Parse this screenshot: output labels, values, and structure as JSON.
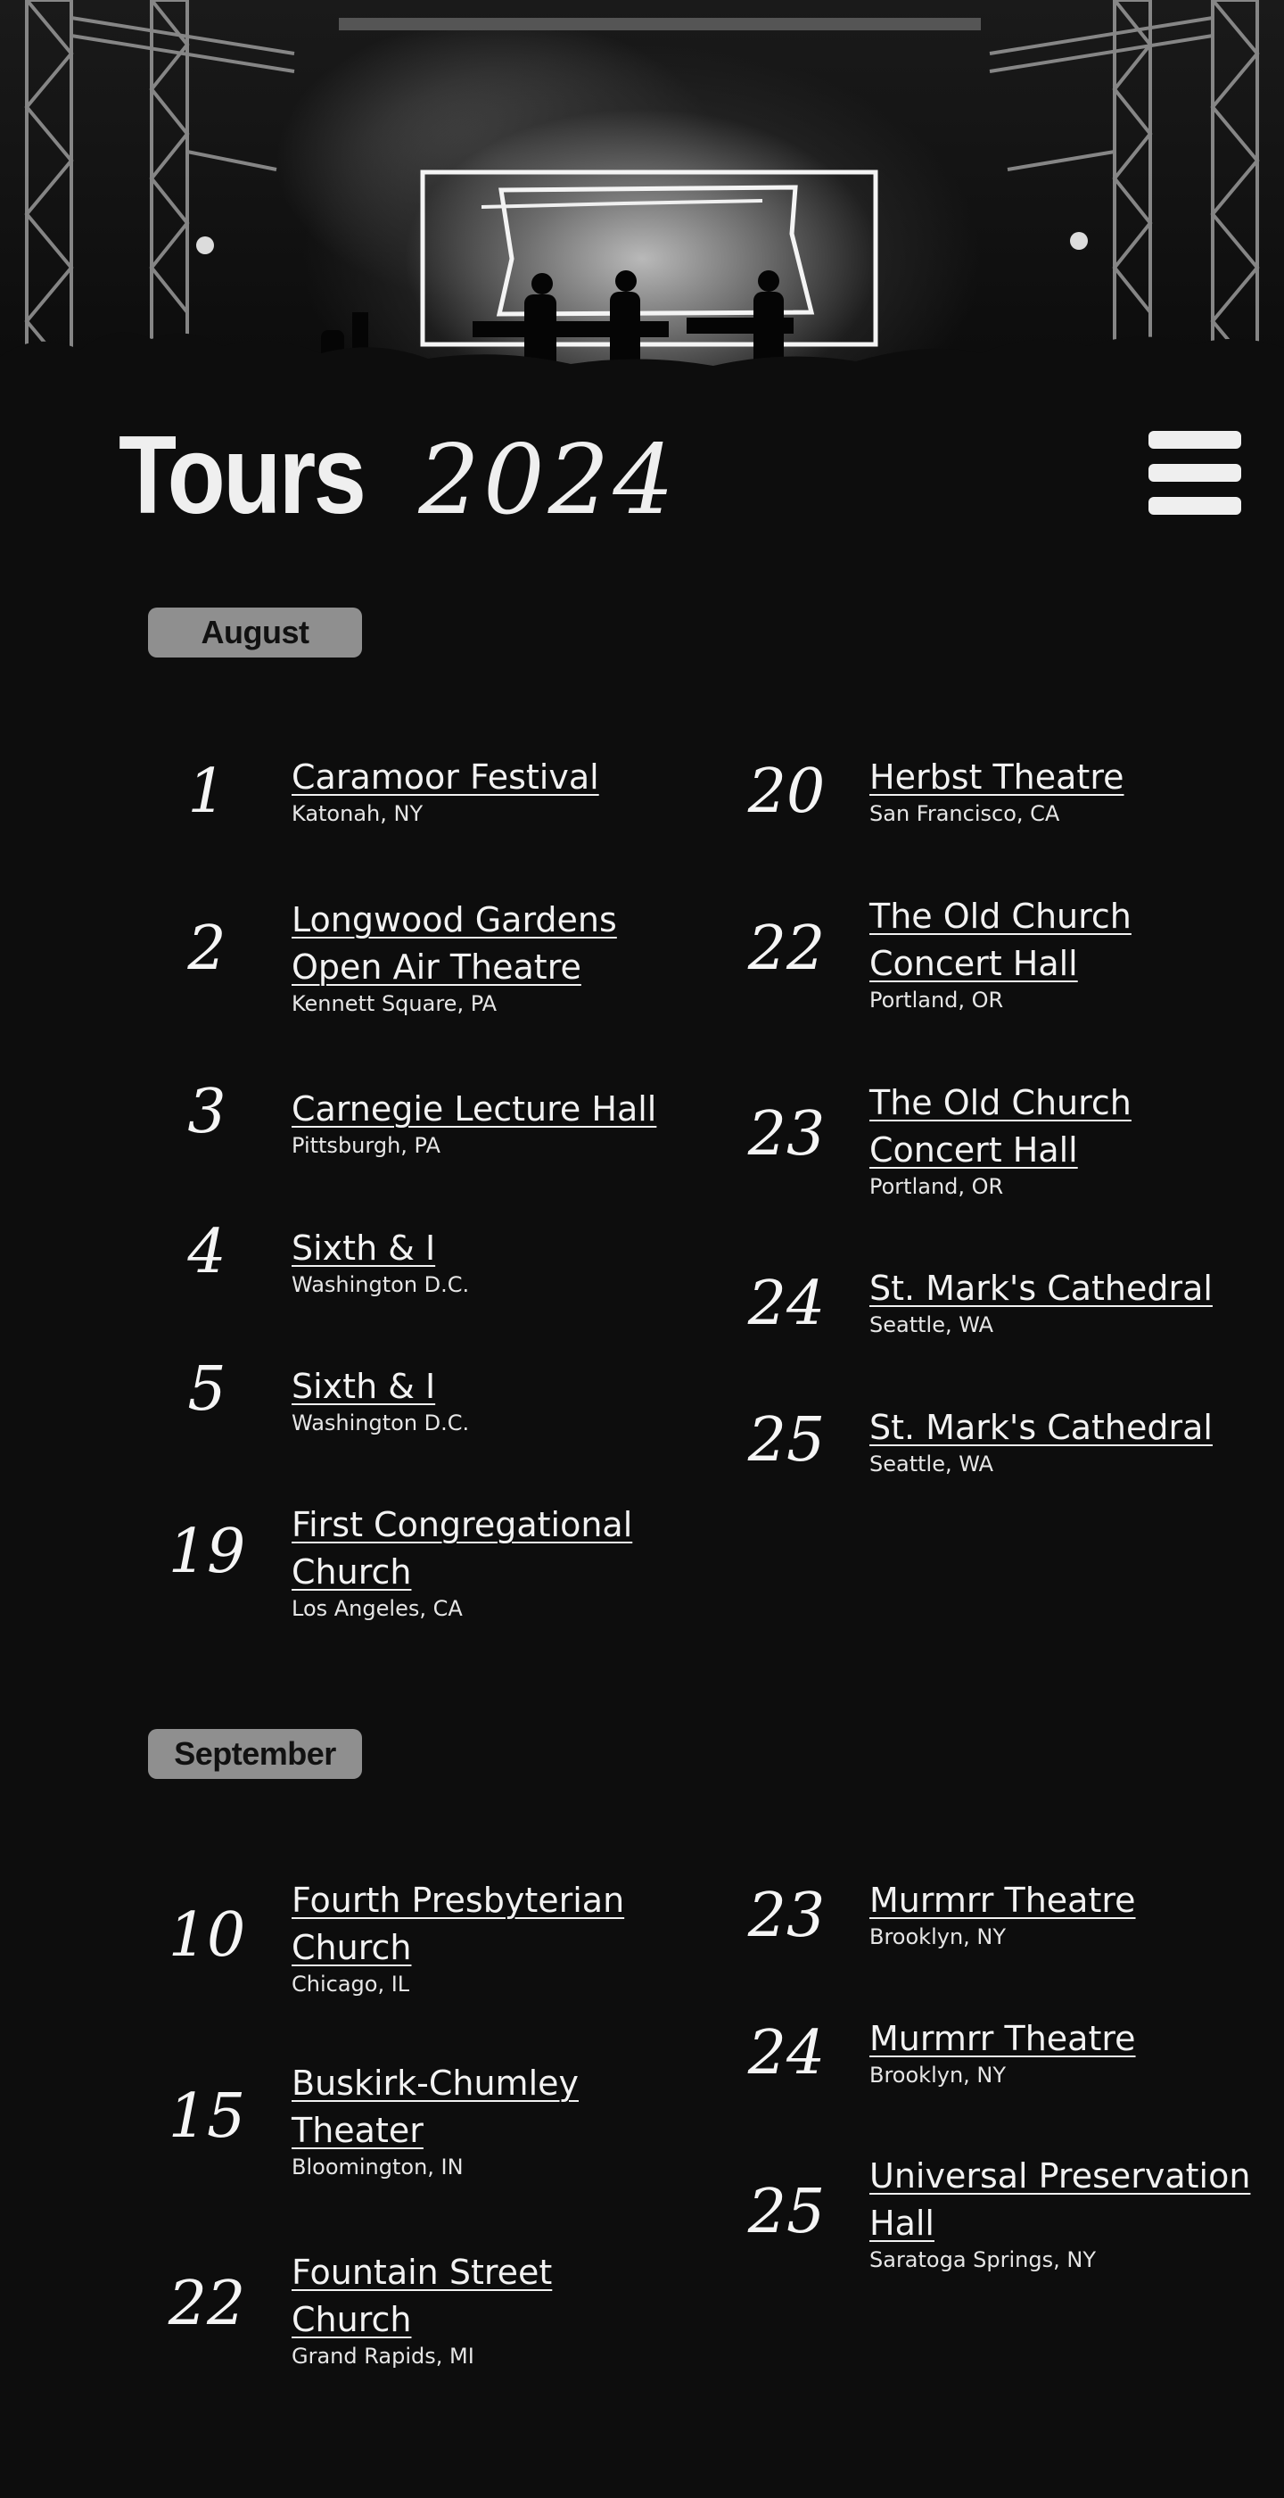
{
  "header": {
    "title_word": "Tours",
    "title_year": "2024"
  },
  "colors": {
    "background": "#0d0d0d",
    "text": "#f2f2f2",
    "badge": "#8f8f8f"
  },
  "icons": {
    "menu": "hamburger-icon"
  },
  "months": [
    {
      "label": "August",
      "left": [
        {
          "day": "1",
          "venue": "Caramoor Festival",
          "city": "Katonah, NY"
        },
        {
          "day": "2",
          "venue_lines": [
            "Longwood Gardens",
            "Open Air Theatre"
          ],
          "city": "Kennett Square, PA"
        },
        {
          "day": "3",
          "venue": "Carnegie Lecture Hall",
          "city": "Pittsburgh, PA"
        },
        {
          "day": "4",
          "venue": "Sixth & I",
          "city": "Washington D.C."
        },
        {
          "day": "5",
          "venue": "Sixth & I",
          "city": "Washington D.C."
        },
        {
          "day": "19",
          "venue_lines": [
            "First Congregational",
            "Church"
          ],
          "city": "Los Angeles, CA"
        }
      ],
      "right": [
        {
          "day": "20",
          "venue": "Herbst Theatre",
          "city": "San Francisco, CA"
        },
        {
          "day": "22",
          "venue_lines": [
            "The Old Church",
            "Concert Hall"
          ],
          "city": "Portland, OR"
        },
        {
          "day": "23",
          "venue_lines": [
            "The Old Church",
            "Concert Hall"
          ],
          "city": "Portland, OR"
        },
        {
          "day": "24",
          "venue": "St. Mark's Cathedral",
          "city": "Seattle, WA"
        },
        {
          "day": "25",
          "venue": "St. Mark's Cathedral",
          "city": "Seattle, WA"
        }
      ]
    },
    {
      "label": "September",
      "left": [
        {
          "day": "10",
          "venue_lines": [
            "Fourth Presbyterian",
            "Church"
          ],
          "city": "Chicago, IL"
        },
        {
          "day": "15",
          "venue_lines": [
            "Buskirk-Chumley",
            "Theater"
          ],
          "city": "Bloomington, IN"
        },
        {
          "day": "22",
          "venue_lines": [
            "Fountain Street",
            "Church"
          ],
          "city": "Grand Rapids, MI"
        }
      ],
      "right": [
        {
          "day": "23",
          "venue": "Murmrr Theatre",
          "city": "Brooklyn, NY"
        },
        {
          "day": "24",
          "venue": "Murmrr Theatre",
          "city": "Brooklyn, NY"
        },
        {
          "day": "25",
          "venue_lines": [
            "Universal Preservation",
            "Hall"
          ],
          "city": "Saratoga Springs, NY"
        }
      ]
    }
  ]
}
